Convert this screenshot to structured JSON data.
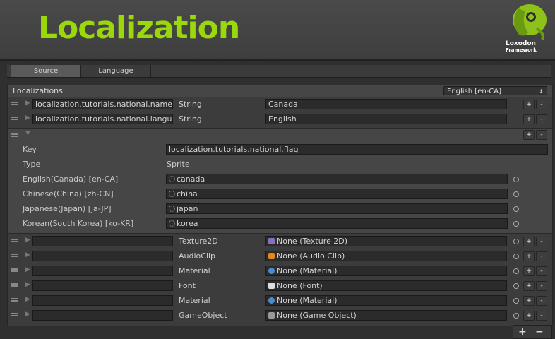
{
  "header": {
    "title": "Localization",
    "logo_line1": "Loxodon",
    "logo_line2": "Framework"
  },
  "tabs": [
    "Source",
    "Language"
  ],
  "localizations": {
    "label": "Localizations",
    "language_select": "English [en-CA]"
  },
  "rows_top": [
    {
      "key": "localization.tutorials.national.name",
      "type": "String",
      "value": "Canada"
    },
    {
      "key": "localization.tutorials.national.language",
      "type": "String",
      "value": "English"
    }
  ],
  "expanded": {
    "key_label": "Key",
    "key_value": "localization.tutorials.national.flag",
    "type_label": "Type",
    "type_value": "Sprite",
    "languages": [
      {
        "name": "English(Canada) [en-CA]",
        "value": "canada"
      },
      {
        "name": "Chinese(China) [zh-CN]",
        "value": "china"
      },
      {
        "name": "Japanese(Japan) [ja-JP]",
        "value": "japan"
      },
      {
        "name": "Korean(South Korea) [ko-KR]",
        "value": "korea"
      }
    ]
  },
  "rows_bottom": [
    {
      "key": "",
      "type": "Texture2D",
      "value": "None (Texture 2D)",
      "icon": "texture-icon",
      "icon_color": "#8a6fc0"
    },
    {
      "key": "",
      "type": "AudioClip",
      "value": "None (Audio Clip)",
      "icon": "audio-icon",
      "icon_color": "#e08a1a"
    },
    {
      "key": "",
      "type": "Material",
      "value": "None (Material)",
      "icon": "material-icon",
      "icon_color": "#4a8ad0"
    },
    {
      "key": "",
      "type": "Font",
      "value": "None (Font)",
      "icon": "font-icon",
      "icon_color": "#dddddd"
    },
    {
      "key": "",
      "type": "Material",
      "value": "None (Material)",
      "icon": "material-icon",
      "icon_color": "#4a8ad0"
    },
    {
      "key": "",
      "type": "GameObject",
      "value": "None (Game Object)",
      "icon": "gameobject-icon",
      "icon_color": "#999999"
    }
  ],
  "buttons": {
    "plus": "+",
    "minus": "-",
    "add": "+",
    "remove": "−"
  },
  "colors": {
    "title": "#9ad80c"
  }
}
